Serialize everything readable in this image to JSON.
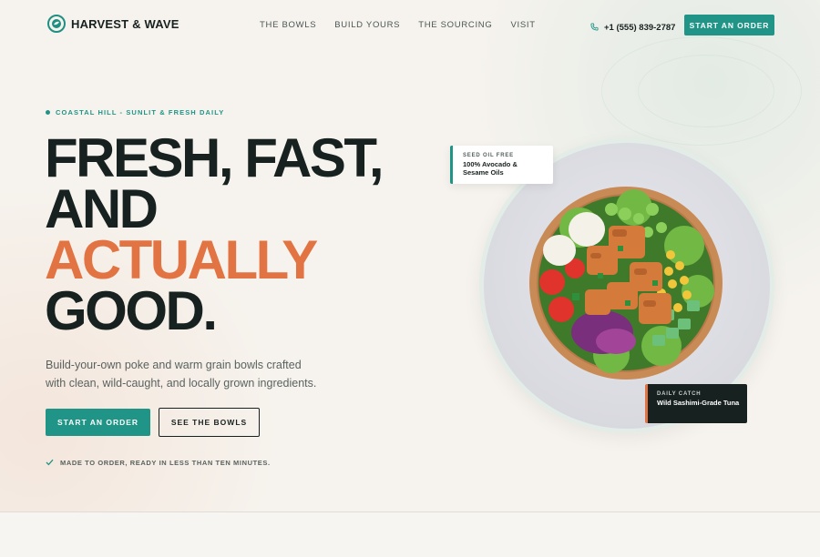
{
  "header": {
    "brand": "HARVEST & WAVE",
    "nav": [
      "THE BOWLS",
      "BUILD YOURS",
      "THE SOURCING",
      "VISIT"
    ],
    "phone": "+1 (555) 839-2787",
    "cta": "START AN ORDER"
  },
  "hero": {
    "eyebrow": "COASTAL HILL - SUNLIT & FRESH DAILY",
    "headline": [
      "FRESH, FAST,",
      "AND",
      "ACTUALLY",
      "GOOD."
    ],
    "lede": "Build-your-own poke and warm grain bowls crafted with clean, wild-caught, and locally grown ingredients.",
    "primary_cta": "START AN ORDER",
    "secondary_cta": "SEE THE BOWLS",
    "note": "MADE TO ORDER, READY IN LESS THAN TEN MINUTES."
  },
  "badges": {
    "seed_label": "SEED OIL FREE",
    "seed_value": "100% Avocado & Sesame Oils",
    "catch_label": "DAILY CATCH",
    "catch_value": "Wild Sashimi-Grade Tuna"
  },
  "colors": {
    "accent": "#1f9487",
    "highlight": "#e27443",
    "ink": "#17211f",
    "background": "#f6f3ee"
  },
  "icons": {
    "logo": "globe-leaf-icon",
    "phone": "phone-icon",
    "note": "check-icon"
  }
}
